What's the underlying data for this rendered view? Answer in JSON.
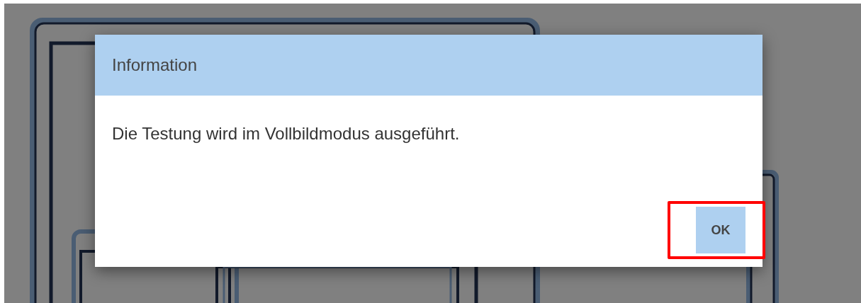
{
  "dialog": {
    "title": "Information",
    "message": "Die Testung wird im Vollbildmodus ausgeführt.",
    "buttons": [
      {
        "label": "OK",
        "highlighted": true
      }
    ]
  }
}
